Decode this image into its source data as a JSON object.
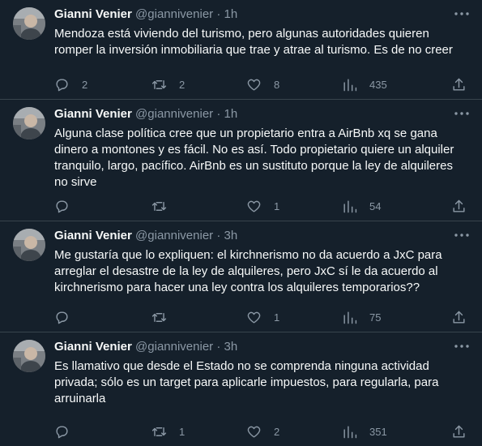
{
  "tweets": [
    {
      "name": "Gianni Venier",
      "handle": "@giannivenier",
      "sep": "·",
      "time": "1h",
      "text": "Mendoza está viviendo del turismo, pero algunas autoridades quieren\nromper la inversión inmobiliaria que trae y atrae al turismo. Es de no creer",
      "replies": "2",
      "retweets": "2",
      "likes": "8",
      "views": "435"
    },
    {
      "name": "Gianni Venier",
      "handle": "@giannivenier",
      "sep": "·",
      "time": "1h",
      "text": "Alguna clase política cree que un propietario entra a AirBnb xq se gana\ndinero a montones y es fácil. No es así. Todo propietario quiere un alquiler\ntranquilo, largo, pacífico. AirBnb es un sustituto porque la ley de alquileres\nno sirve",
      "replies": "",
      "retweets": "",
      "likes": "1",
      "views": "54"
    },
    {
      "name": "Gianni Venier",
      "handle": "@giannivenier",
      "sep": "·",
      "time": "3h",
      "text": "Me gustaría que lo expliquen: el kirchnerismo no da acuerdo a JxC para\narreglar el desastre de la ley de alquileres, pero JxC sí le da acuerdo al\nkirchnerismo para hacer una ley contra los alquileres temporarios??",
      "replies": "",
      "retweets": "",
      "likes": "1",
      "views": "75"
    },
    {
      "name": "Gianni Venier",
      "handle": "@giannivenier",
      "sep": "·",
      "time": "3h",
      "text": "Es llamativo que desde el Estado no se comprenda ninguna actividad\nprivada; sólo es un target para aplicarle impuestos, para regularla, para\narruinarla",
      "replies": "",
      "retweets": "1",
      "likes": "2",
      "views": "351"
    }
  ],
  "icons": {
    "more": "more-dots-icon",
    "reply": "reply-bubble-icon",
    "retweet": "retweet-arrows-icon",
    "like": "heart-icon",
    "views": "bar-chart-icon",
    "share": "share-upload-icon"
  },
  "colors": {
    "background": "#15202b",
    "text": "#f7f9f9",
    "muted": "#8b98a5",
    "divider": "#38444d"
  }
}
